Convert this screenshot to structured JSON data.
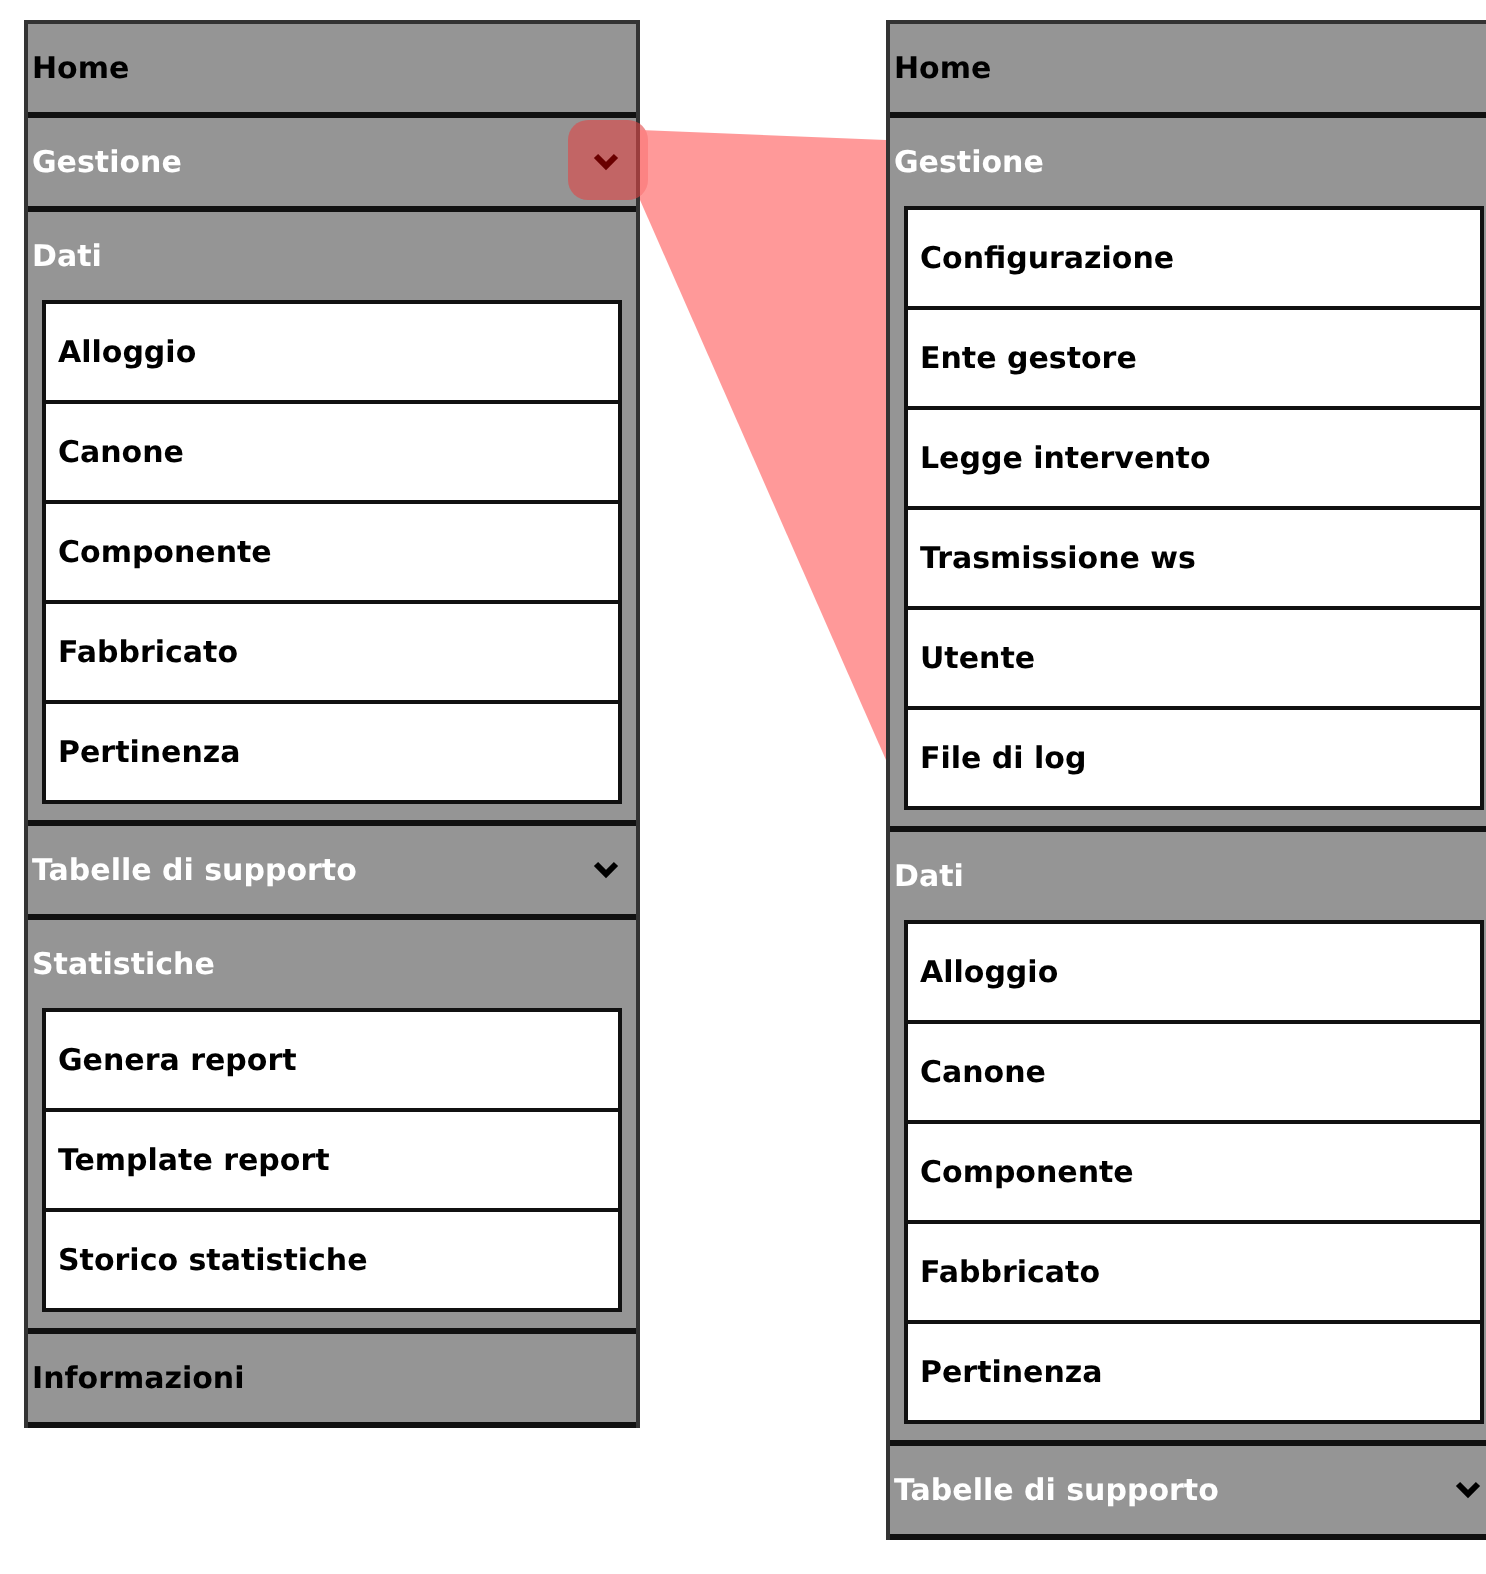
{
  "menus": [
    {
      "sections": [
        {
          "kind": "link",
          "label": "Home"
        },
        {
          "kind": "group",
          "label": "Gestione",
          "expanded": false,
          "highlighted": true
        },
        {
          "kind": "group",
          "label": "Dati",
          "expanded": true,
          "items": [
            "Alloggio",
            "Canone",
            "Componente",
            "Fabbricato",
            "Pertinenza"
          ]
        },
        {
          "kind": "group",
          "label": "Tabelle di supporto",
          "expanded": false,
          "highlighted": false
        },
        {
          "kind": "group",
          "label": "Statistiche",
          "expanded": true,
          "items": [
            "Genera report",
            "Template report",
            "Storico statistiche"
          ]
        },
        {
          "kind": "link",
          "label": "Informazioni"
        }
      ]
    },
    {
      "sections": [
        {
          "kind": "link",
          "label": "Home"
        },
        {
          "kind": "group",
          "label": "Gestione",
          "expanded": true,
          "items": [
            "Configurazione",
            "Ente gestore",
            "Legge intervento",
            "Trasmissione ws",
            "Utente",
            "File di log"
          ]
        },
        {
          "kind": "group",
          "label": "Dati",
          "expanded": true,
          "items": [
            "Alloggio",
            "Canone",
            "Componente",
            "Fabbricato",
            "Pertinenza"
          ]
        },
        {
          "kind": "group",
          "label": "Tabelle di supporto",
          "expanded": false,
          "highlighted": false
        }
      ]
    }
  ]
}
